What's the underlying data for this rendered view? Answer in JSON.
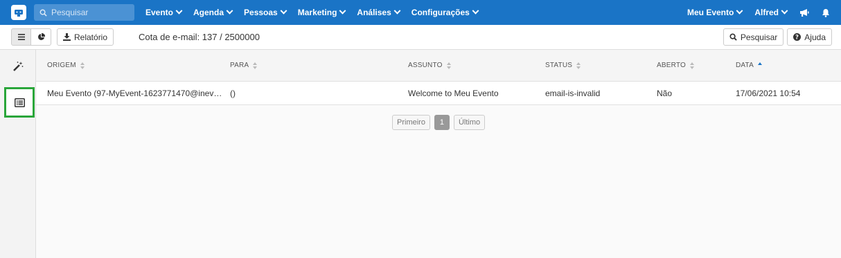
{
  "navbar": {
    "search_placeholder": "Pesquisar",
    "menu": [
      "Evento",
      "Agenda",
      "Pessoas",
      "Marketing",
      "Análises",
      "Configurações"
    ],
    "event_label": "Meu Evento",
    "user_label": "Alfred"
  },
  "toolbar": {
    "report_label": "Relatório",
    "quota_text": "Cota de e-mail: 137 / 2500000",
    "search_label": "Pesquisar",
    "help_label": "Ajuda"
  },
  "table": {
    "headers": [
      "ORIGEM",
      "PARA",
      "ASSUNTO",
      "STATUS",
      "ABERTO",
      "DATA"
    ],
    "rows": [
      [
        "Meu Evento (97-MyEvent-1623771470@inevent…",
        "()",
        "Welcome to Meu Evento",
        "email-is-invalid",
        "Não",
        "17/06/2021 10:54"
      ]
    ]
  },
  "pagination": {
    "first_label": "Primeiro",
    "current_page": "1",
    "last_label": "Último"
  },
  "colors": {
    "navbar": "#1a74c6",
    "active_highlight": "#2aa63a"
  }
}
